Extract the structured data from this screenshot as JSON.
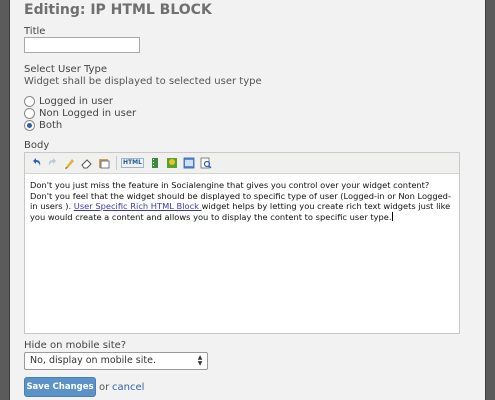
{
  "dialog": {
    "title": "Editing: IP HTML BLOCK"
  },
  "form": {
    "title_label": "Title",
    "title_value": "",
    "user_type_label": "Select User Type",
    "user_type_desc": "Widget shall be displayed to selected user type",
    "user_type_options": [
      {
        "label": "Logged in user",
        "checked": false
      },
      {
        "label": "Non Logged in user",
        "checked": false
      },
      {
        "label": "Both",
        "checked": true
      }
    ],
    "body_label": "Body",
    "body": {
      "text_before": "Don't you just miss the feature in Socialengine that gives you control over your widget content? Don't you feel that the widget should be displayed to specific type of user (Logged-in or Non Logged-in users ). ",
      "link_text": "User Specific Rich HTML Block ",
      "text_after": "widget helps by letting you create rich text widgets just like you would create a content and allows you to display the content to specific user type."
    },
    "mobile_label": "Hide on mobile site?",
    "mobile_selected": "No, display on mobile site.",
    "save_label": "Save Changes",
    "or_text": "or",
    "cancel_label": "cancel"
  },
  "toolbar_icons": [
    "undo-icon",
    "redo-icon",
    "cleanup-icon",
    "eraser-icon",
    "paste-icon",
    "html-icon",
    "media-icon",
    "image-icon",
    "table-icon",
    "preview-icon"
  ],
  "colors": {
    "accent": "#5b93c8",
    "link": "#2a66b0",
    "background": "#f2f2f2"
  }
}
